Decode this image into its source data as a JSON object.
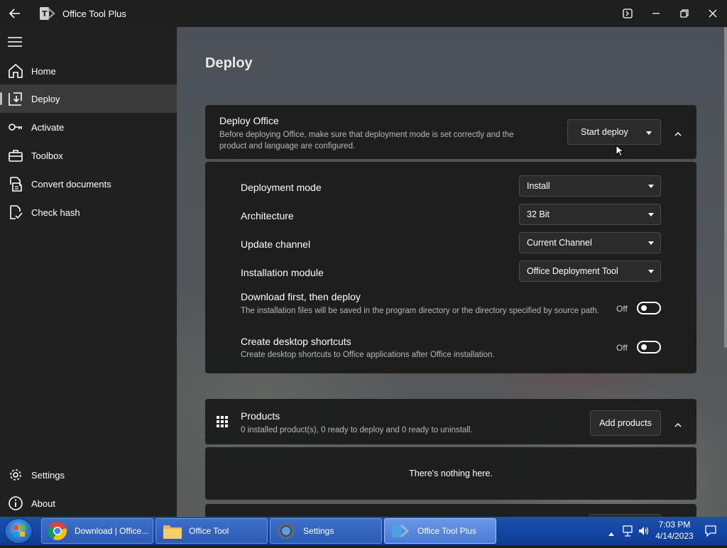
{
  "app": {
    "title": "Office Tool Plus",
    "logo_text": "T"
  },
  "sidebar": {
    "items": [
      {
        "label": "Home",
        "icon": "home-icon"
      },
      {
        "label": "Deploy",
        "icon": "deploy-icon"
      },
      {
        "label": "Activate",
        "icon": "key-icon"
      },
      {
        "label": "Toolbox",
        "icon": "toolbox-icon"
      },
      {
        "label": "Convert documents",
        "icon": "convert-documents-icon"
      },
      {
        "label": "Check hash",
        "icon": "check-hash-icon"
      }
    ],
    "footer": [
      {
        "label": "Settings",
        "icon": "gear-icon"
      },
      {
        "label": "About",
        "icon": "info-icon"
      }
    ]
  },
  "main": {
    "page_title": "Deploy",
    "deploy_office": {
      "title": "Deploy Office",
      "description": "Before deploying Office, make sure that deployment mode is set correctly and the product and language are configured.",
      "start_button": "Start deploy"
    },
    "settings": {
      "deployment_mode": {
        "label": "Deployment mode",
        "value": "Install"
      },
      "architecture": {
        "label": "Architecture",
        "value": "32 Bit"
      },
      "update_channel": {
        "label": "Update channel",
        "value": "Current Channel"
      },
      "installation_module": {
        "label": "Installation module",
        "value": "Office Deployment Tool"
      },
      "download_first": {
        "label": "Download first, then deploy",
        "description": "The installation files will be saved in the program directory or the directory specified by source path.",
        "state": "Off"
      },
      "desktop_shortcuts": {
        "label": "Create desktop shortcuts",
        "description": "Create desktop shortcuts to Office applications after Office installation.",
        "state": "Off"
      }
    },
    "products": {
      "title": "Products",
      "summary": "0 installed product(s), 0 ready to deploy and 0 ready to uninstall.",
      "add_button": "Add products",
      "empty_text": "There's nothing here."
    }
  },
  "taskbar": {
    "items": [
      {
        "label": "Download | Office...",
        "icon": "chrome-icon"
      },
      {
        "label": "Office Tool",
        "icon": "folder-icon"
      },
      {
        "label": "Settings",
        "icon": "settings-app-icon"
      },
      {
        "label": "Office Tool Plus",
        "icon": "office-tool-plus-icon",
        "active": true
      }
    ],
    "clock": {
      "time": "7:03 PM",
      "date": "4/14/2023"
    }
  },
  "colors": {
    "sidebar_bg": "#202020",
    "card_bg": "#1c1c1c",
    "taskbar_blue": "#1446a8"
  }
}
